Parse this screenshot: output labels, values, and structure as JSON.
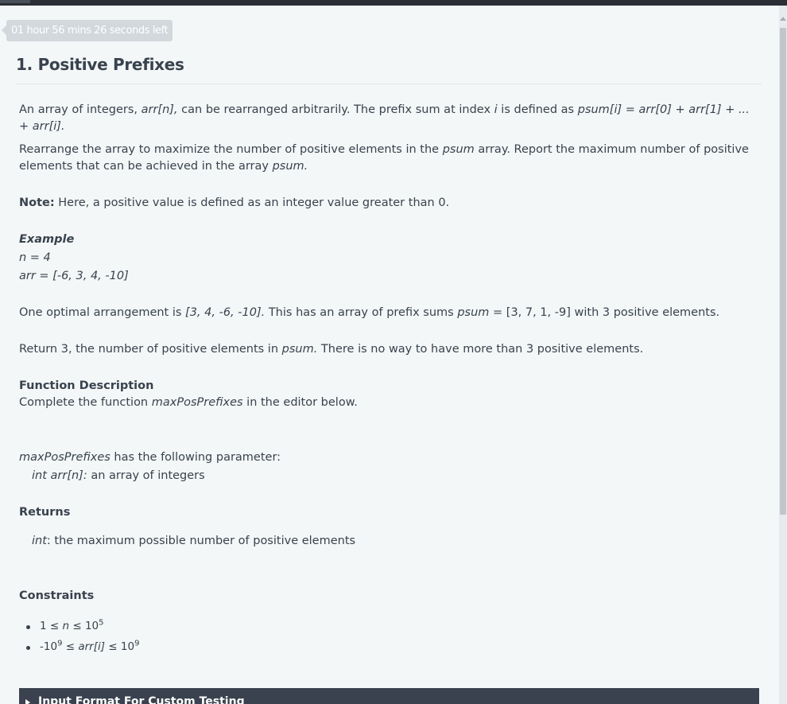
{
  "timer": {
    "text": "01 hour 56 mins 26 seconds left"
  },
  "problem": {
    "title": "1. Positive Prefixes",
    "intro": {
      "t1": "An array of integers, ",
      "arr": "arr[n],",
      "t2": " can be rearranged arbitrarily. The prefix sum at index ",
      "i": "i",
      "t3": " is defined as ",
      "formula": "psum[i] = arr[0] + arr[1] + ... + arr[i]."
    },
    "task": {
      "t1": "Rearrange the array to maximize the number of positive elements in the ",
      "psum": "psum",
      "t2": " array. Report the maximum number of positive elements that can be achieved in the array ",
      "psum2": "psum."
    },
    "note": {
      "label": "Note:",
      "text": " Here, a positive value is defined as an integer value greater than 0."
    },
    "example": {
      "heading": "Example",
      "n": "n  = 4",
      "arr": "arr = [-6, 3, 4, -10]",
      "optimal": {
        "t1": "One optimal arrangement is ",
        "arrangement": "[3, 4, -6, -10].",
        "t2": " This has an array of prefix sums ",
        "psum": "psum",
        "t3": " = [3, 7, 1, -9] with 3 positive elements."
      },
      "ret": {
        "t1": "Return 3, the number of positive elements in ",
        "psum": "psum.",
        "t2": " There is no way to have more than 3 positive elements."
      }
    },
    "function_description": {
      "heading": "Function Description",
      "t1": "Complete the function ",
      "fname": "maxPosPrefixes",
      "t2": " in the editor below."
    },
    "parameters": {
      "fname": "maxPosPrefixes",
      "t1": " has the following parameter:",
      "param_type": "int arr[n]:",
      "param_desc": " an array of integers"
    },
    "returns": {
      "heading": "Returns",
      "type": "int",
      "desc": ": the maximum possible number of positive elements"
    },
    "constraints": {
      "heading": "Constraints",
      "c1": {
        "a": "1 ≤ ",
        "n": "n",
        "b": " ≤ 10",
        "exp": "5"
      },
      "c2": {
        "a": "-10",
        "exp1": "9",
        "b": " ≤ ",
        "arr": "arr[i]",
        "c": " ≤ 10",
        "exp2": "9"
      }
    }
  },
  "input_section": {
    "label": "Input Format For Custom Testing"
  }
}
